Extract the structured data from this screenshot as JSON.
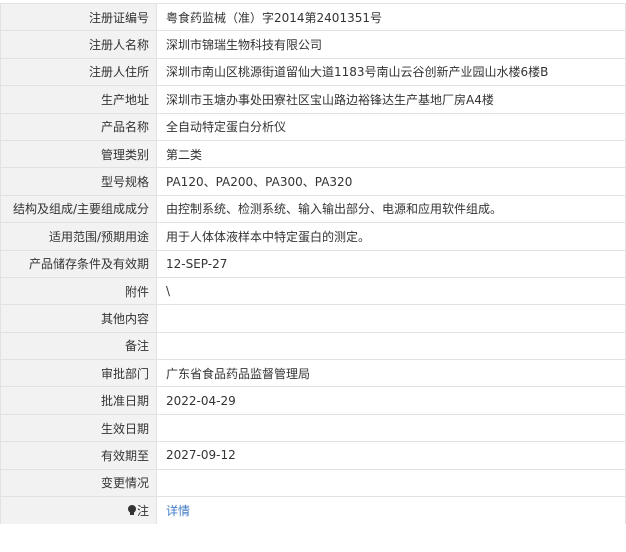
{
  "rows": [
    {
      "label": "注册证编号",
      "value": "粤食药监械（准）字2014第2401351号"
    },
    {
      "label": "注册人名称",
      "value": "深圳市锦瑞生物科技有限公司"
    },
    {
      "label": "注册人住所",
      "value": "深圳市南山区桃源街道留仙大道1183号南山云谷创新产业园山水楼6楼B"
    },
    {
      "label": "生产地址",
      "value": "深圳市玉塘办事处田寮社区宝山路边裕锋达生产基地厂房A4楼"
    },
    {
      "label": "产品名称",
      "value": "全自动特定蛋白分析仪"
    },
    {
      "label": "管理类别",
      "value": "第二类"
    },
    {
      "label": "型号规格",
      "value": "PA120、PA200、PA300、PA320"
    },
    {
      "label": "结构及组成/主要组成成分",
      "value": "由控制系统、检测系统、输入输出部分、电源和应用软件组成。"
    },
    {
      "label": "适用范围/预期用途",
      "value": "用于人体体液样本中特定蛋白的测定。"
    },
    {
      "label": "产品储存条件及有效期",
      "value": "12-SEP-27"
    },
    {
      "label": "附件",
      "value": "\\"
    },
    {
      "label": "其他内容",
      "value": ""
    },
    {
      "label": "备注",
      "value": ""
    },
    {
      "label": "审批部门",
      "value": "广东省食品药品监督管理局"
    },
    {
      "label": "批准日期",
      "value": "2022-04-29"
    },
    {
      "label": "生效日期",
      "value": ""
    },
    {
      "label": "有效期至",
      "value": "2027-09-12"
    },
    {
      "label": "变更情况",
      "value": ""
    }
  ],
  "note": {
    "label": "注",
    "icon": "lightbulb-icon",
    "link_text": "详情",
    "link_color": "#3e7bc4"
  }
}
